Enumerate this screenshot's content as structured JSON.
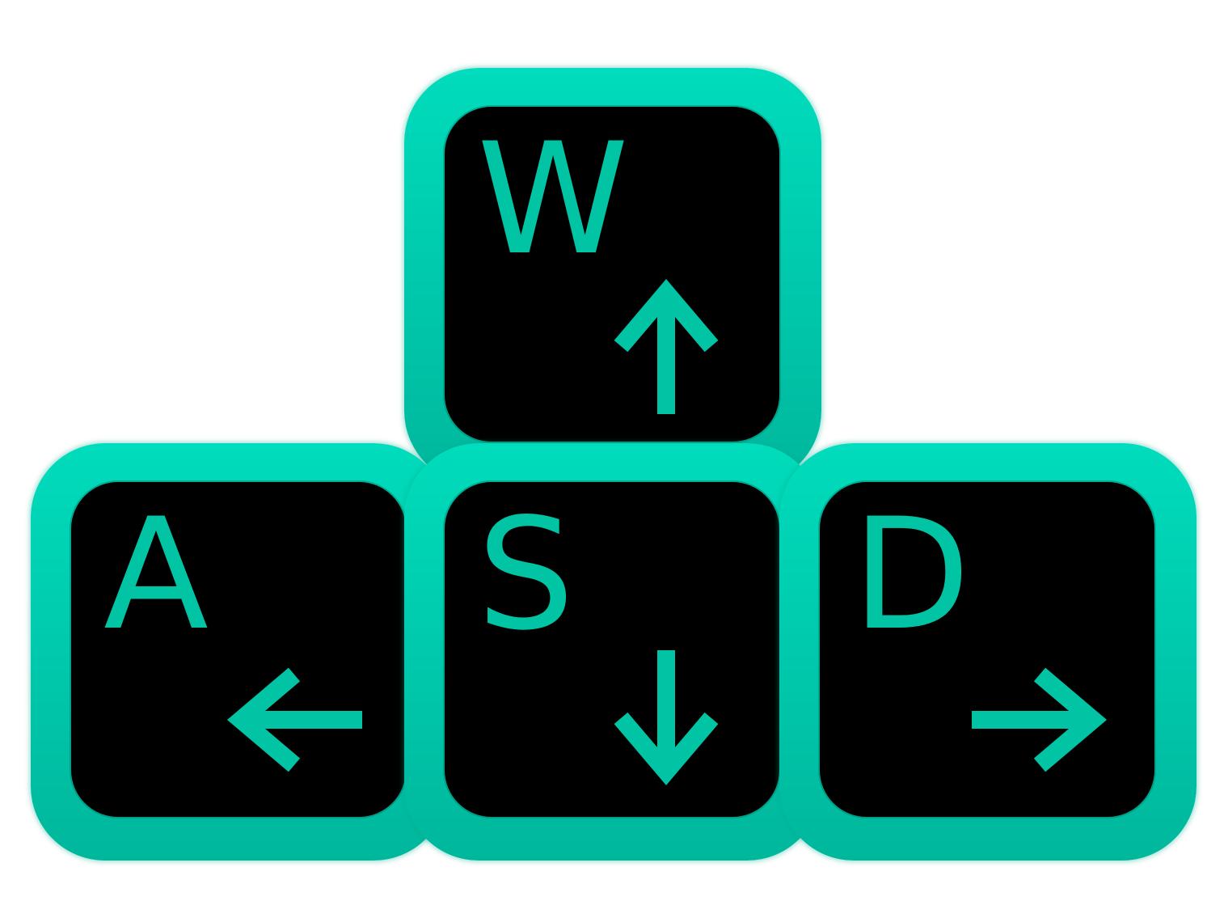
{
  "colors": {
    "key_border": "#00d4b5",
    "key_face": "#000000",
    "glyph": "#00c4a4",
    "background": "#ffffff"
  },
  "keys": [
    {
      "letter": "W",
      "arrow_icon": "arrow-up-icon"
    },
    {
      "letter": "A",
      "arrow_icon": "arrow-left-icon"
    },
    {
      "letter": "S",
      "arrow_icon": "arrow-down-icon"
    },
    {
      "letter": "D",
      "arrow_icon": "arrow-right-icon"
    }
  ]
}
